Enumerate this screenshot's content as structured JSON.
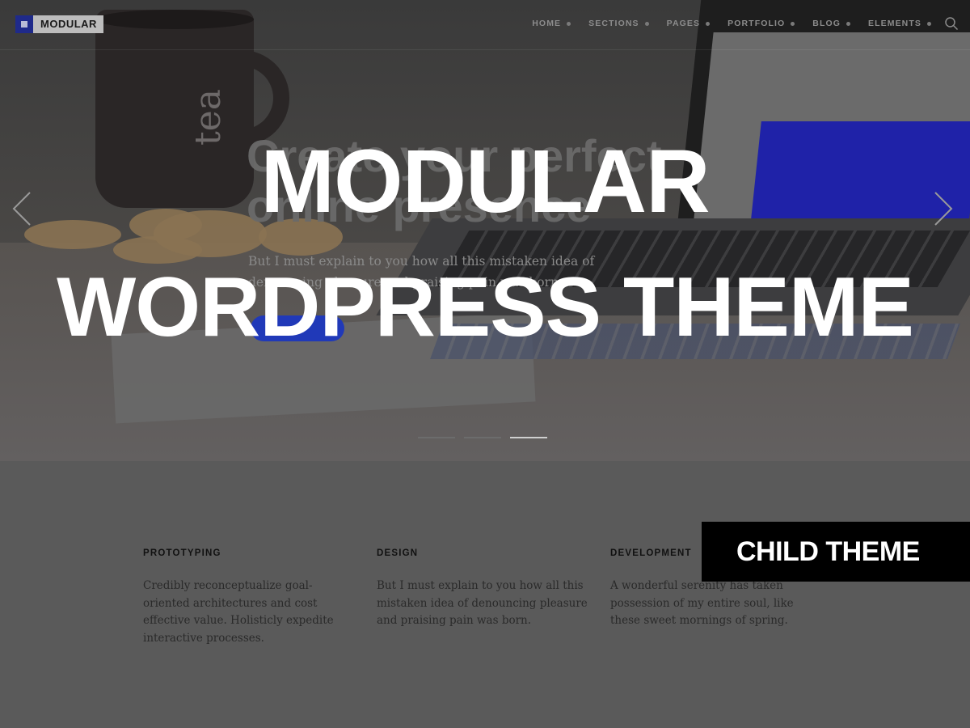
{
  "brand": {
    "name": "MODULAR"
  },
  "nav": {
    "items": [
      {
        "label": "HOME"
      },
      {
        "label": "SECTIONS"
      },
      {
        "label": "PAGES"
      },
      {
        "label": "PORTFOLIO"
      },
      {
        "label": "BLOG"
      },
      {
        "label": "ELEMENTS"
      }
    ],
    "search_icon": "search-icon"
  },
  "hero": {
    "mug_text": "tea",
    "slide_heading": "Create your perfect online presence",
    "slide_text": "But I must explain to you how all this mistaken idea of denouncing pleasure and praising pain was born.",
    "title_line1": "MODULAR",
    "title_line2": "WORDPRESS THEME",
    "prev_icon": "chevron-left-icon",
    "next_icon": "chevron-right-icon",
    "slides_total": 3,
    "active_slide": 3
  },
  "features": [
    {
      "title": "PROTOTYPING",
      "text": "Credibly reconceptualize goal-oriented architectures and cost effective value. Holisticly expedite interactive processes."
    },
    {
      "title": "DESIGN",
      "text": "But I must explain to you how all this mistaken idea of denouncing pleasure and praising pain was born."
    },
    {
      "title": "DEVELOPMENT",
      "text": "A wonderful serenity has taken possession of my entire soul, like these sweet mornings of spring."
    }
  ],
  "badge": {
    "label": "CHILD THEME"
  },
  "colors": {
    "accent": "#1f2a8a",
    "button": "#2039b8",
    "overlay_text": "#ffffff",
    "badge_bg": "#000000"
  }
}
